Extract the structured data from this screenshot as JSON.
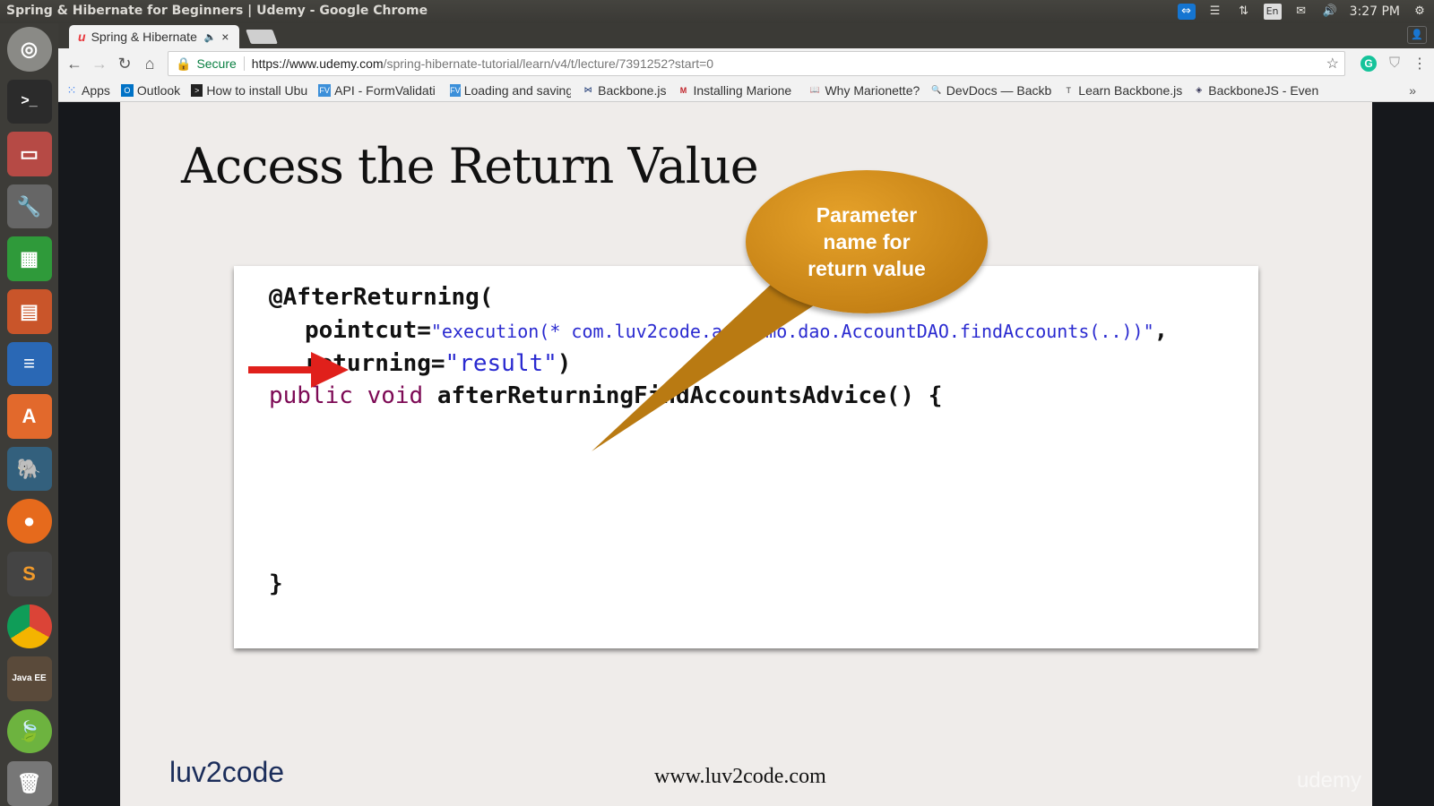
{
  "window": {
    "title": "Spring & Hibernate for Beginners | Udemy - Google Chrome",
    "clock": "3:27 PM",
    "lang": "En"
  },
  "tab": {
    "label": "Spring & Hibernate for Beginners | Udemy"
  },
  "address": {
    "secure": "Secure",
    "url_host": "https://www.udemy.com",
    "url_path": "/spring-hibernate-tutorial/learn/v4/t/lecture/7391252?start=0"
  },
  "bookmarks": [
    {
      "label": "Apps",
      "icon": "apps-grid-icon",
      "color": "#4285f4"
    },
    {
      "label": "Outlook",
      "icon": "outlook-icon",
      "color": "#0072c6"
    },
    {
      "label": "How to install Ubu",
      "icon": "terminal-icon",
      "color": "#222"
    },
    {
      "label": "API - FormValidati",
      "icon": "fv-icon",
      "color": "#3b8fd9"
    },
    {
      "label": "Loading and saving",
      "icon": "fv-icon",
      "color": "#3b8fd9"
    },
    {
      "label": "Backbone.js",
      "icon": "backbone-icon",
      "color": "#0d2b6b"
    },
    {
      "label": "Installing Marione",
      "icon": "marionette-icon",
      "color": "#c0242b"
    },
    {
      "label": "Why Marionette?",
      "icon": "book-icon",
      "color": "#555"
    },
    {
      "label": "DevDocs — Backb",
      "icon": "search-doc-icon",
      "color": "#555"
    },
    {
      "label": "Learn Backbone.js",
      "icon": "t-icon",
      "color": "#444"
    },
    {
      "label": "BackboneJS - Even",
      "icon": "diamond-icon",
      "color": "#335"
    }
  ],
  "slide": {
    "title": "Access the Return Value",
    "callout": "Parameter name for return value",
    "code": {
      "line1": "@AfterReturning(",
      "pointcut_key": "pointcut=",
      "pointcut_value": "\"execution(* com.luv2code.aopdemo.dao.AccountDAO.findAccounts(..))\"",
      "comma": ",",
      "returning_key": "returning=",
      "returning_value": "\"result\"",
      "returning_close": ")",
      "kw_public": "public",
      "kw_void": "void",
      "method": "afterReturningFindAccountsAdvice() {",
      "close": "}"
    },
    "logo": "luv2code",
    "website": "www.luv2code.com",
    "watermark": "udemy"
  },
  "colors": {
    "callout": "#d08a15",
    "arrow": "#e0201b",
    "string": "#2a2ad0",
    "keyword": "#7d0a55"
  }
}
